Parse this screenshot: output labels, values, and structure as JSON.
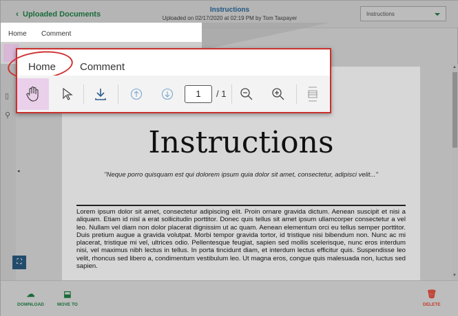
{
  "header": {
    "back_label": "Uploaded Documents",
    "title": "Instructions",
    "subtitle": "Uploaded on 02/17/2020 at 02:19 PM by Tom Taxpayer",
    "select_value": "Instructions"
  },
  "small_toolbar": {
    "tab_home": "Home",
    "tab_comment": "Comment"
  },
  "zoom_toolbar": {
    "tab_home": "Home",
    "tab_comment": "Comment",
    "current_page": "1",
    "total_pages": "/ 1"
  },
  "document": {
    "title": "Instructions",
    "quote": "\"Neque porro quisquam est qui dolorem ipsum quia dolor sit amet, consectetur, adipisci velit...\"",
    "body": "Lorem ipsum dolor sit amet, consectetur adipiscing elit. Proin ornare gravida dictum. Aenean suscipit et nisi a aliquam. Etiam id nisl a erat sollicitudin porttitor. Donec quis tellus sit amet ipsum ullamcorper consectetur a vel leo. Nullam vel diam non dolor placerat dignissim ut ac quam. Aenean elementum orci eu tellus semper porttitor. Duis pretium augue a gravida volutpat. Morbi tempor gravida tortor, id tristique nisi bibendum non. Nunc ac mi placerat, tristique mi vel, ultrices odio. Pellentesque feugiat, sapien sed mollis scelerisque, nunc eros interdum nisi, vel maximus nibh lectus in tellus. In porta tincidunt diam, et interdum lectus efficitur quis. Suspendisse leo velit, rhoncus sed libero a, condimentum vestibulum leo. Ut magna eros, congue quis malesuada non, luctus sed sapien."
  },
  "actions": {
    "download": "DOWNLOAD",
    "move_to": "MOVE TO",
    "delete": "DELETE"
  },
  "colors": {
    "accent_green": "#1a6b3a",
    "title_blue": "#1f5580",
    "highlight_red": "#c9302c",
    "active_tool": "#ead0ea"
  }
}
